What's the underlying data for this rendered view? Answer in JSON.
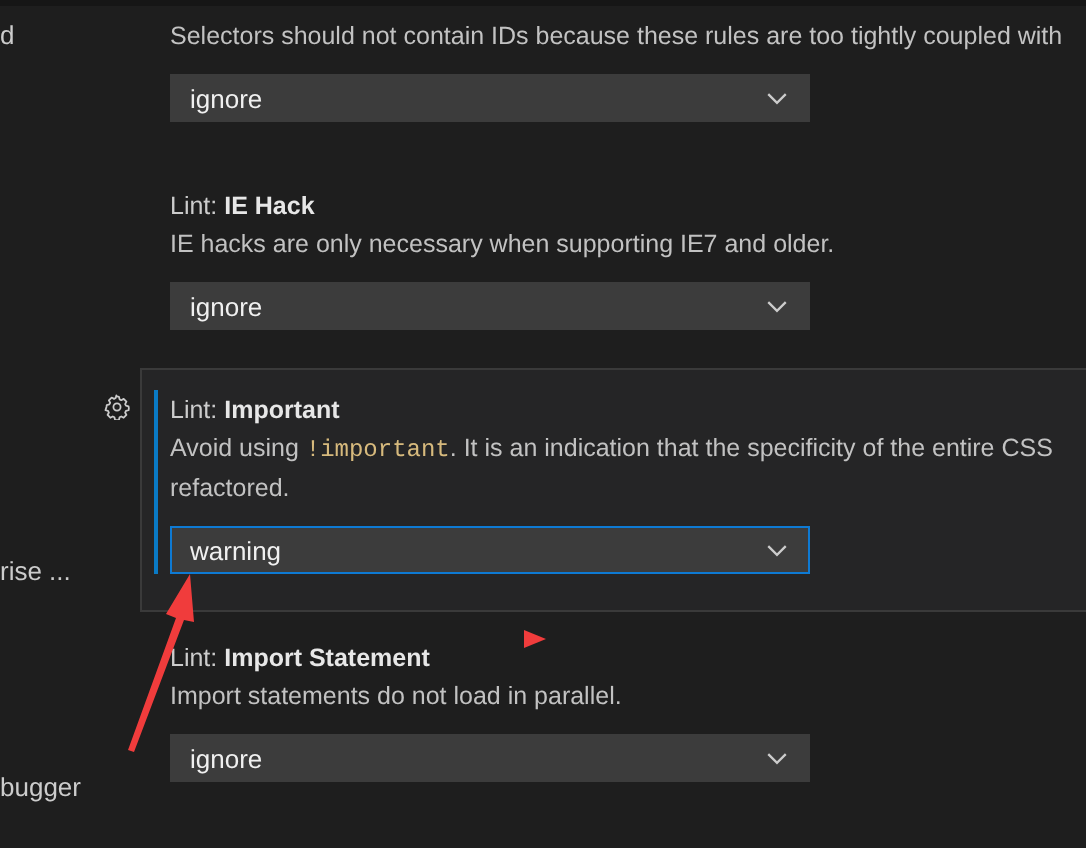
{
  "sidebar": {
    "items": [
      {
        "label": "d"
      },
      {
        "label": "rise ..."
      },
      {
        "label": "bugger"
      }
    ]
  },
  "settings": [
    {
      "description": [
        [
          {
            "kind": "text",
            "text": "Selectors should not contain IDs because these rules are too tightly coupled with"
          }
        ]
      ],
      "value": "ignore",
      "focused": false
    },
    {
      "title": "Lint: **IE Hack**",
      "description": [
        [
          {
            "kind": "text",
            "text": "IE hacks are only necessary when supporting IE7 and older."
          }
        ]
      ],
      "value": "ignore",
      "focused": false
    },
    {
      "title": "Lint: **Important**",
      "description": [
        [
          {
            "kind": "text",
            "text": "Avoid using "
          },
          {
            "kind": "code",
            "text": "!important"
          },
          {
            "kind": "text",
            "text": ". It is an indication that the specificity of the entire CSS"
          }
        ],
        [
          {
            "kind": "text",
            "text": "refactored."
          }
        ]
      ],
      "value": "warning",
      "focused": true
    },
    {
      "title": "Lint: **Import Statement**",
      "description": [
        [
          {
            "kind": "text",
            "text": "Import statements do not load in parallel."
          }
        ]
      ],
      "value": "ignore",
      "focused": false
    }
  ]
}
